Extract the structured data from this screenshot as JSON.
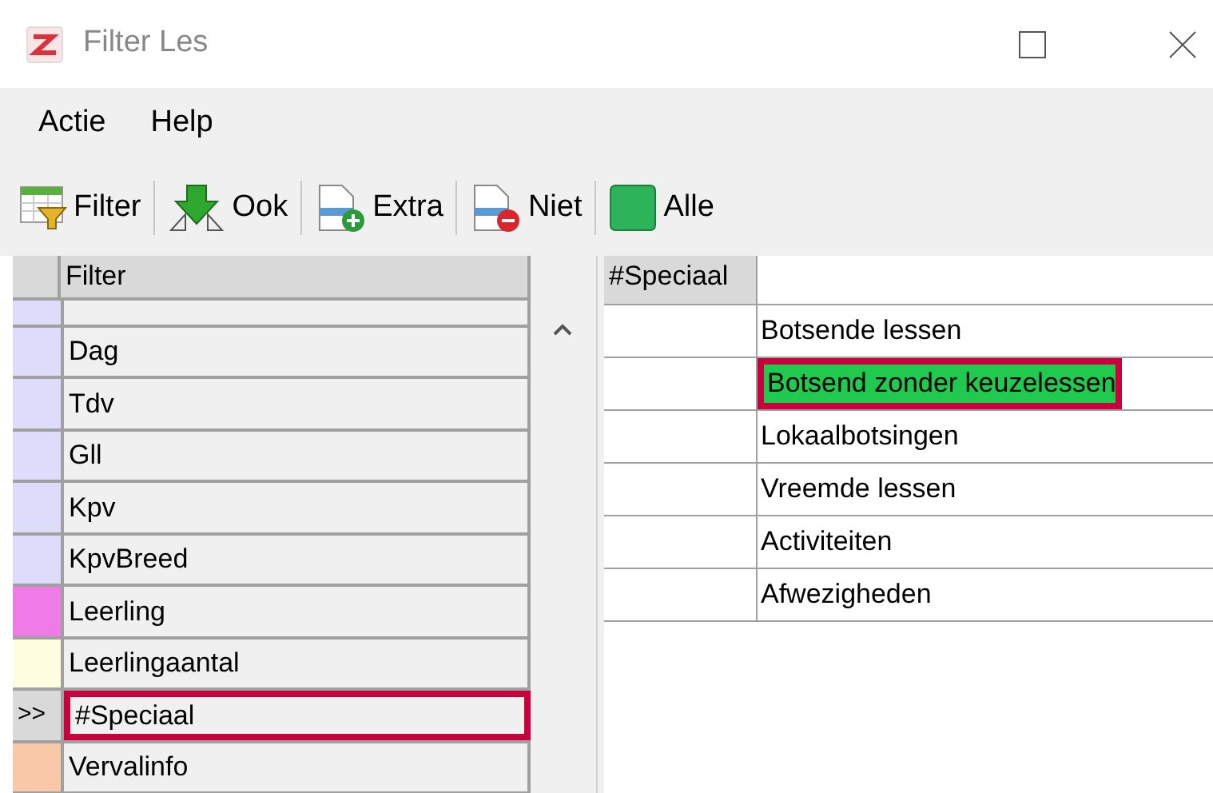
{
  "window": {
    "title": "Filter Les"
  },
  "menu": [
    "Actie",
    "Help"
  ],
  "toolbar": [
    {
      "label": "Filter",
      "kind": "filter"
    },
    {
      "label": "Ook",
      "kind": "ook"
    },
    {
      "label": "Extra",
      "kind": "extra"
    },
    {
      "label": "Niet",
      "kind": "niet"
    },
    {
      "label": "Alle",
      "kind": "alle"
    }
  ],
  "filter_table": {
    "header": "Filter",
    "rows": [
      {
        "label": "",
        "color": "#ddddfb",
        "selected": false
      },
      {
        "label": "Dag",
        "color": "#ddddfb",
        "selected": false
      },
      {
        "label": "Tdv",
        "color": "#ddddfb",
        "selected": false
      },
      {
        "label": "Gll",
        "color": "#ddddfb",
        "selected": false
      },
      {
        "label": "Kpv",
        "color": "#ddddfb",
        "selected": false
      },
      {
        "label": "KpvBreed",
        "color": "#ddddfb",
        "selected": false
      },
      {
        "label": "Leerling",
        "color": "#ef7be6",
        "selected": false
      },
      {
        "label": "Leerlingaantal",
        "color": "#fffee0",
        "selected": false
      },
      {
        "label": "#Speciaal",
        "marker": ">>",
        "selected": true
      },
      {
        "label": "Vervalinfo",
        "color": "#f9c8a8",
        "selected": false
      }
    ]
  },
  "special_table": {
    "header": "#Speciaal",
    "rows": [
      {
        "label": "Botsende lessen",
        "selected": false
      },
      {
        "label": "Botsend zonder keuzelessen",
        "selected": true
      },
      {
        "label": "Lokaalbotsingen",
        "selected": false
      },
      {
        "label": "Vreemde lessen",
        "selected": false
      },
      {
        "label": "Activiteiten",
        "selected": false
      },
      {
        "label": "Afwezigheden",
        "selected": false
      }
    ]
  }
}
